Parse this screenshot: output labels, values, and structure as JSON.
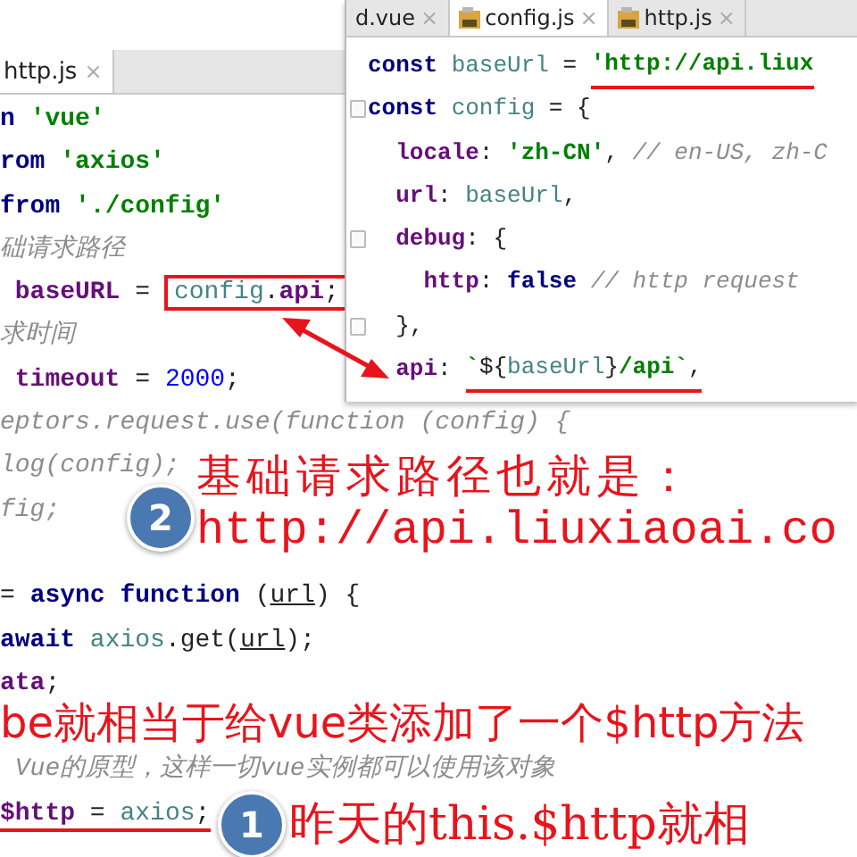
{
  "editor": {
    "tabs": [
      {
        "label": "http.js",
        "close": "×",
        "selected": true
      }
    ],
    "lines": [
      {
        "tokens": [
          {
            "kind": "keyword",
            "text": "n "
          },
          {
            "kind": "string",
            "text": "'vue'"
          }
        ]
      },
      {
        "tokens": [
          {
            "kind": "keyword",
            "text": "rom "
          },
          {
            "kind": "string",
            "text": "'axios'"
          }
        ]
      },
      {
        "tokens": [
          {
            "kind": "keyword",
            "text": "from "
          },
          {
            "kind": "string",
            "text": "'./config'"
          }
        ]
      },
      {
        "tokens": [
          {
            "kind": "comment",
            "text": "础请求路径"
          }
        ]
      },
      {
        "tokens": [
          {
            "kind": "prop",
            "text": " baseURL"
          },
          {
            "kind": "plain",
            "text": " = "
          },
          {
            "kind": "group",
            "boxed": true,
            "tokens": [
              {
                "kind": "ident",
                "text": "config"
              },
              {
                "kind": "plain",
                "text": "."
              },
              {
                "kind": "prop",
                "text": "api"
              },
              {
                "kind": "plain",
                "text": ";"
              }
            ]
          }
        ]
      },
      {
        "tokens": [
          {
            "kind": "comment",
            "text": "求时间"
          }
        ]
      },
      {
        "tokens": [
          {
            "kind": "prop",
            "text": " timeout"
          },
          {
            "kind": "plain",
            "text": " = "
          },
          {
            "kind": "number",
            "text": "2000"
          },
          {
            "kind": "plain",
            "text": ";"
          }
        ]
      },
      {
        "tokens": [
          {
            "kind": "comment",
            "text": "eptors.request.use(function (config) {"
          }
        ]
      },
      {
        "tokens": [
          {
            "kind": "comment",
            "text": "log(config);"
          }
        ]
      },
      {
        "tokens": [
          {
            "kind": "comment",
            "text": "fig;"
          }
        ]
      },
      {
        "space_before": true,
        "tokens": [
          {
            "kind": "plain",
            "text": "= "
          },
          {
            "kind": "keyword",
            "text": "async function "
          },
          {
            "kind": "plain",
            "text": "("
          },
          {
            "kind": "param",
            "text": "url"
          },
          {
            "kind": "plain",
            "text": ") {"
          }
        ]
      },
      {
        "tokens": [
          {
            "kind": "keyword",
            "text": "await "
          },
          {
            "kind": "ident",
            "text": "axios"
          },
          {
            "kind": "plain",
            "text": ".get("
          },
          {
            "kind": "param",
            "text": "url"
          },
          {
            "kind": "plain",
            "text": ");"
          }
        ]
      },
      {
        "tokens": [
          {
            "kind": "prop",
            "text": "ata"
          },
          {
            "kind": "plain",
            "text": ";"
          }
        ]
      },
      {
        "space_before": true,
        "tokens": [
          {
            "kind": "comment",
            "text": " Vue的原型，这样一切vue实例都可以使用该对象"
          }
        ]
      },
      {
        "tokens": [
          {
            "kind": "group",
            "underlined": true,
            "tokens": [
              {
                "kind": "prop",
                "text": "$http"
              },
              {
                "kind": "plain",
                "text": " = "
              },
              {
                "kind": "ident",
                "text": "axios"
              },
              {
                "kind": "plain",
                "text": ";"
              }
            ]
          }
        ]
      }
    ]
  },
  "config_editor": {
    "tabs": [
      {
        "label": "d.vue",
        "close": "×",
        "icon": false,
        "selected": false
      },
      {
        "label": "config.js",
        "close": "×",
        "icon": true,
        "selected": true
      },
      {
        "label": "http.js",
        "close": "×",
        "icon": true,
        "selected": false
      }
    ],
    "lines": [
      {
        "tokens": [
          {
            "kind": "keyword",
            "text": "const "
          },
          {
            "kind": "ident",
            "text": "baseUrl"
          },
          {
            "kind": "plain",
            "text": " = "
          },
          {
            "kind": "group",
            "underlined": true,
            "tokens": [
              {
                "kind": "string",
                "text": "'http://api.liux"
              }
            ]
          }
        ]
      },
      {
        "fold": true,
        "tokens": [
          {
            "kind": "keyword",
            "text": "const "
          },
          {
            "kind": "ident",
            "text": "config"
          },
          {
            "kind": "plain",
            "text": " = {"
          }
        ]
      },
      {
        "tokens": [
          {
            "kind": "prop",
            "text": "  locale"
          },
          {
            "kind": "plain",
            "text": ": "
          },
          {
            "kind": "string",
            "text": "'zh-CN'"
          },
          {
            "kind": "plain",
            "text": ", "
          },
          {
            "kind": "comment",
            "text": "// en-US, zh-C"
          }
        ]
      },
      {
        "tokens": [
          {
            "kind": "prop",
            "text": "  url"
          },
          {
            "kind": "plain",
            "text": ": "
          },
          {
            "kind": "ident",
            "text": "baseUrl"
          },
          {
            "kind": "plain",
            "text": ","
          }
        ]
      },
      {
        "fold": true,
        "tokens": [
          {
            "kind": "prop",
            "text": "  debug"
          },
          {
            "kind": "plain",
            "text": ": {"
          }
        ]
      },
      {
        "tokens": [
          {
            "kind": "prop",
            "text": "    http"
          },
          {
            "kind": "plain",
            "text": ": "
          },
          {
            "kind": "keyword",
            "text": "false "
          },
          {
            "kind": "comment",
            "text": "// http request"
          }
        ]
      },
      {
        "fold": true,
        "tokens": [
          {
            "kind": "plain",
            "text": "  },"
          }
        ]
      },
      {
        "tokens": [
          {
            "kind": "prop",
            "text": "  api"
          },
          {
            "kind": "plain",
            "text": ": "
          },
          {
            "kind": "group",
            "underlined": true,
            "tokens": [
              {
                "kind": "string",
                "text": "`"
              },
              {
                "kind": "plain",
                "text": "${"
              },
              {
                "kind": "ident",
                "text": "baseUrl"
              },
              {
                "kind": "plain",
                "text": "}"
              },
              {
                "kind": "string",
                "text": "/api`"
              },
              {
                "kind": "plain",
                "text": ","
              }
            ]
          }
        ]
      }
    ]
  },
  "annotations": [
    {
      "badge": "2",
      "lines": [
        "基础请求路径也就是：",
        "http://api.liuxiaoai.co"
      ]
    },
    {
      "text": "be就相当于给vue类添加了一个$http方法"
    },
    {
      "badge": "1",
      "lines": [
        "昨天的this.$http就相"
      ]
    }
  ]
}
